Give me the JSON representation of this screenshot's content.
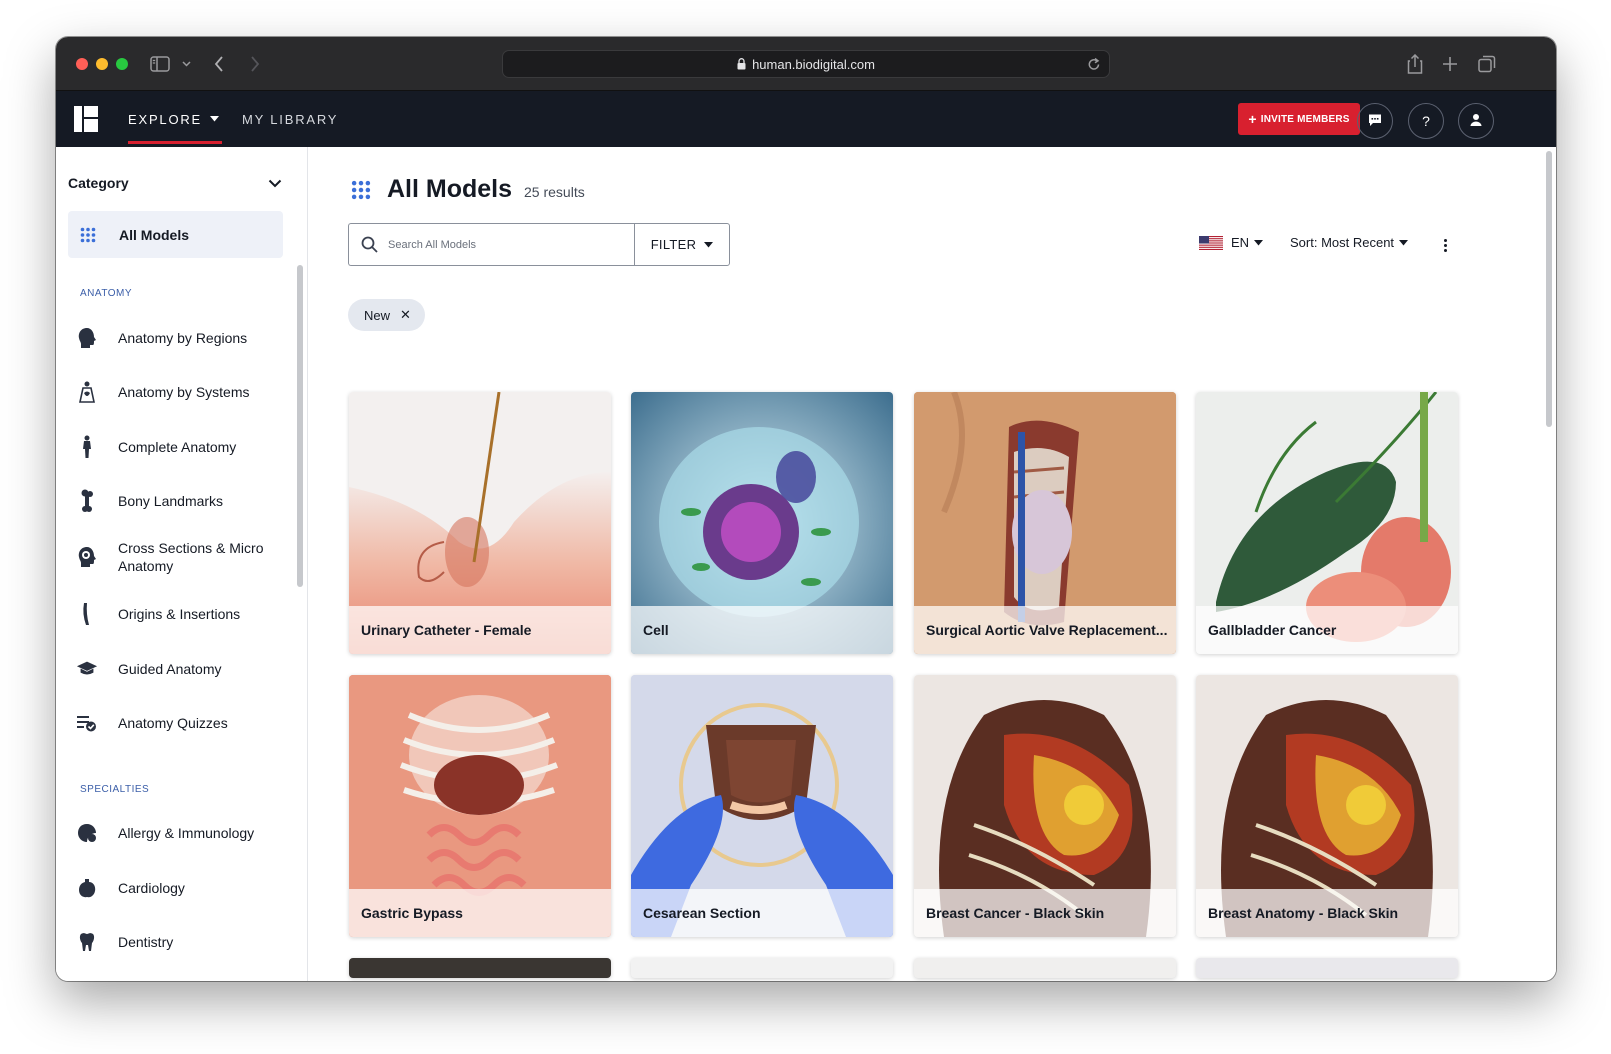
{
  "browser": {
    "url": "human.biodigital.com"
  },
  "nav": {
    "explore_label": "EXPLORE",
    "library_label": "MY LIBRARY",
    "invite_label": "INVITE MEMBERS",
    "invite_plus": "+",
    "help_label": "?",
    "accent": "#d8202f"
  },
  "sidebar": {
    "category_label": "Category",
    "all_models_label": "All Models",
    "anatomy_section": "ANATOMY",
    "anatomy_items": [
      {
        "label": "Anatomy by Regions",
        "icon": "head-profile-icon"
      },
      {
        "label": "Anatomy by Systems",
        "icon": "body-systems-icon"
      },
      {
        "label": "Complete Anatomy",
        "icon": "standing-figure-icon"
      },
      {
        "label": "Bony Landmarks",
        "icon": "bone-icon"
      },
      {
        "label": "Cross Sections & Micro Anatomy",
        "icon": "cross-section-icon"
      },
      {
        "label": "Origins & Insertions",
        "icon": "muscle-icon"
      },
      {
        "label": "Guided Anatomy",
        "icon": "graduation-cap-icon"
      },
      {
        "label": "Anatomy Quizzes",
        "icon": "quiz-list-icon"
      }
    ],
    "specialties_section": "SPECIALTIES",
    "specialty_items": [
      {
        "label": "Allergy & Immunology",
        "icon": "immunology-icon"
      },
      {
        "label": "Cardiology",
        "icon": "heart-icon"
      },
      {
        "label": "Dentistry",
        "icon": "tooth-icon"
      }
    ]
  },
  "main": {
    "title": "All Models",
    "results": "25 results",
    "search_placeholder": "Search All Models",
    "filter_label": "FILTER",
    "language": "EN",
    "sort_label": "Sort: Most Recent",
    "chip_label": "New",
    "chip_close": "✕"
  },
  "cards": [
    {
      "title": "Urinary Catheter - Female"
    },
    {
      "title": "Cell"
    },
    {
      "title": "Surgical Aortic Valve Replacement..."
    },
    {
      "title": "Gallbladder Cancer"
    },
    {
      "title": "Gastric Bypass"
    },
    {
      "title": "Cesarean Section"
    },
    {
      "title": "Breast Cancer - Black Skin"
    },
    {
      "title": "Breast Anatomy - Black Skin"
    }
  ]
}
